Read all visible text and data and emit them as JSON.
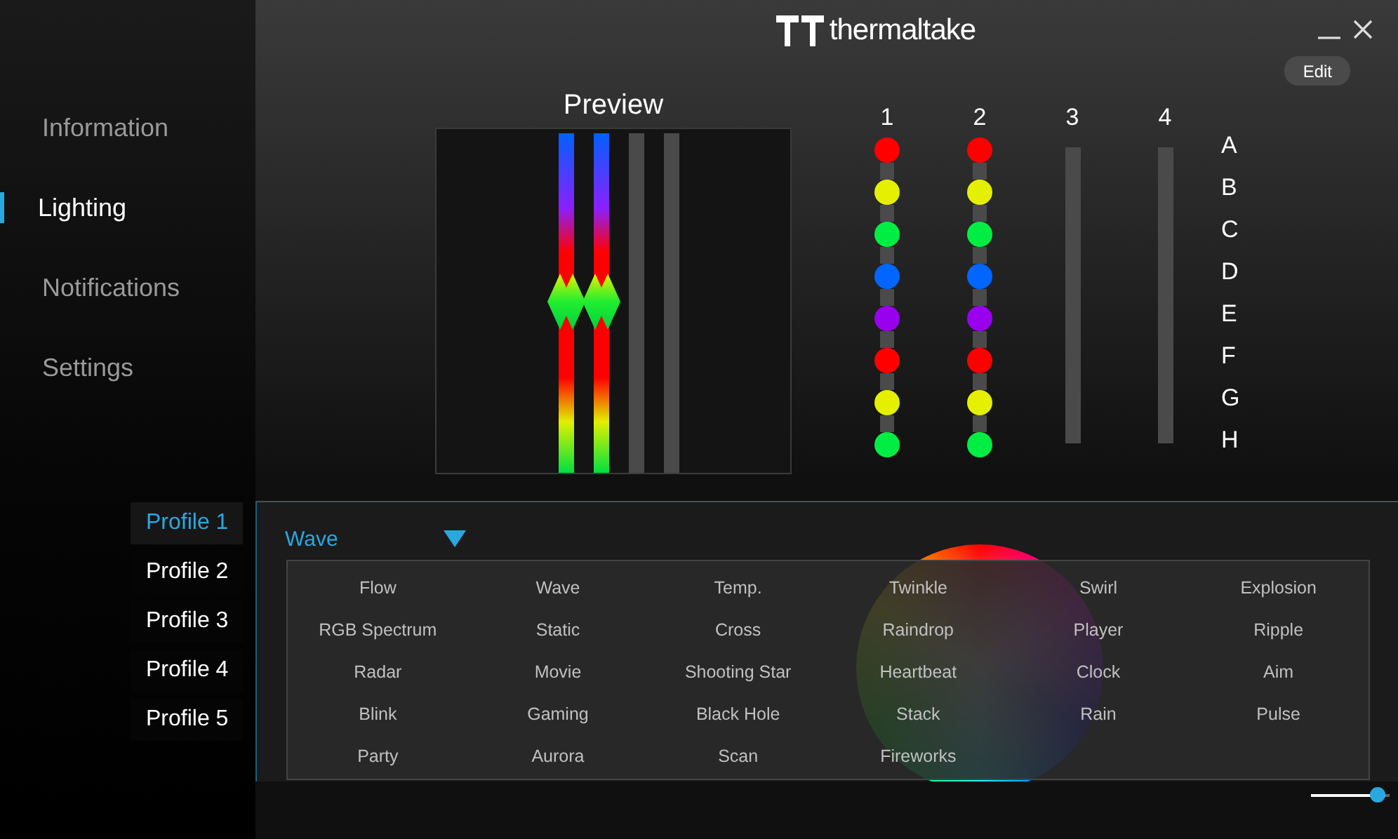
{
  "window": {
    "logo_text": "thermaltake"
  },
  "edit_button": "Edit",
  "nav": [
    {
      "label": "Information",
      "selected": false
    },
    {
      "label": "Lighting",
      "selected": true
    },
    {
      "label": "Notifications",
      "selected": false
    },
    {
      "label": "Settings",
      "selected": false
    }
  ],
  "profiles": [
    {
      "label": "Profile 1",
      "selected": true
    },
    {
      "label": "Profile 2",
      "selected": false
    },
    {
      "label": "Profile 3",
      "selected": false
    },
    {
      "label": "Profile 4",
      "selected": false
    },
    {
      "label": "Profile 5",
      "selected": false
    }
  ],
  "preview": {
    "title": "Preview",
    "strips": [
      {
        "lit": true
      },
      {
        "lit": true
      },
      {
        "lit": false
      },
      {
        "lit": false
      }
    ]
  },
  "fans": [
    {
      "label": "1",
      "leds": [
        {
          "color": "#ff0000"
        },
        {
          "color": "#e5f000"
        },
        {
          "color": "#00ee44"
        },
        {
          "color": "#0066ff"
        },
        {
          "color": "#9900ee"
        },
        {
          "color": "#ff0000"
        },
        {
          "color": "#e5f000"
        },
        {
          "color": "#00ee44"
        }
      ]
    },
    {
      "label": "2",
      "leds": [
        {
          "color": "#ff0000"
        },
        {
          "color": "#e5f000"
        },
        {
          "color": "#00ee44"
        },
        {
          "color": "#0066ff"
        },
        {
          "color": "#9900ee"
        },
        {
          "color": "#ff0000"
        },
        {
          "color": "#e5f000"
        },
        {
          "color": "#00ee44"
        }
      ]
    },
    {
      "label": "3"
    },
    {
      "label": "4"
    }
  ],
  "led_labels": [
    "A",
    "B",
    "C",
    "D",
    "E",
    "F",
    "G",
    "H"
  ],
  "effect": {
    "value": "Wave",
    "expanded": true,
    "options": [
      "Flow",
      "Wave",
      "Temp.",
      "Twinkle",
      "Swirl",
      "Explosion",
      "RGB Spectrum",
      "Static",
      "Cross",
      "Raindrop",
      "Player",
      "Ripple",
      "Radar",
      "Movie",
      "Shooting Star",
      "Heartbeat",
      "Clock",
      "Aim",
      "Blink",
      "Gaming",
      "Black Hole",
      "Stack",
      "Rain",
      "Pulse",
      "Party",
      "Aurora",
      "Scan",
      "Fireworks"
    ]
  },
  "brightness": {
    "level": 0.95
  }
}
